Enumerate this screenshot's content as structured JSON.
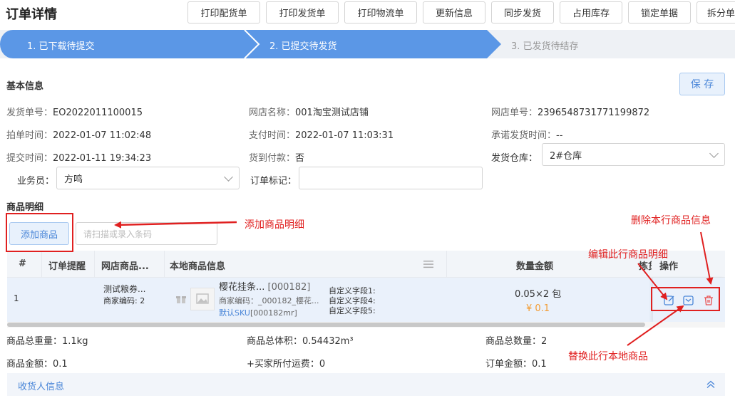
{
  "header": {
    "title": "订单详情",
    "buttons": [
      "打印配货单",
      "打印发货单",
      "打印物流单",
      "更新信息",
      "同步发货",
      "占用库存",
      "锁定单据",
      "拆分单"
    ]
  },
  "steps": [
    "1. 已下载待提交",
    "2. 已提交待发货",
    "3. 已发货待结存"
  ],
  "basic": {
    "title": "基本信息",
    "save_label": "保 存",
    "fields": [
      {
        "label": "发货单号：",
        "value": "EO2022011100015"
      },
      {
        "label": "网店名称：",
        "value": "001淘宝测试店铺"
      },
      {
        "label": "网店单号：",
        "value": "2396548731771199872"
      },
      {
        "label": "拍单时间：",
        "value": "2022-01-07 11:02:48"
      },
      {
        "label": "支付时间：",
        "value": "2022-01-07 11:03:31"
      },
      {
        "label": "承诺发货时间：",
        "value": "--"
      },
      {
        "label": "提交时间：",
        "value": "2022-01-11 19:34:23"
      },
      {
        "label": "货到付款：",
        "value": "否"
      },
      {
        "label": "发货仓库：",
        "value": "2#仓库"
      },
      {
        "label": "业务员：",
        "value": "方鸣"
      },
      {
        "label": "订单标记：",
        "value": ""
      }
    ]
  },
  "goods": {
    "title": "商品明细",
    "add_label": "添加商品",
    "scan_placeholder": "请扫描或录入条码",
    "headers": [
      "#",
      "订单提醒",
      "网店商品...",
      "本地商品信息",
      "数量金额",
      "拣货",
      "操作"
    ],
    "row": {
      "index": "1",
      "shop_goods": "测试粮券...",
      "shop_code": "商家编码: 2",
      "local_name": "樱花挂条...",
      "local_code_tag": "[000182]",
      "merchant_code": "商家编码：_000182_樱花...",
      "sku": "默认SKU",
      "sku_code": "[000182mr]",
      "custom1": "自定义字段1:",
      "custom4": "自定义字段4:",
      "custom5": "自定义字段5:",
      "qty": "0.05×2 包",
      "amount": "¥ 0.1"
    }
  },
  "summary": {
    "weight": "商品总重量：1.1kg",
    "volume": "商品总体积：0.54432m³",
    "count": "商品总数量：2",
    "goods_amount": "商品金额：0.1",
    "freight": "+买家所付运费：0",
    "order_amount": "订单金额：0.1"
  },
  "receiver": {
    "title": "收货人信息"
  },
  "annotations": {
    "add_detail": "添加商品明细",
    "delete_row": "删除本行商品信息",
    "edit_row": "编辑此行商品明细",
    "replace_row": "替换此行本地商品"
  },
  "colors": {
    "accent": "#4a86d8",
    "step_active": "#5b97e6",
    "annotation": "#e02020"
  }
}
